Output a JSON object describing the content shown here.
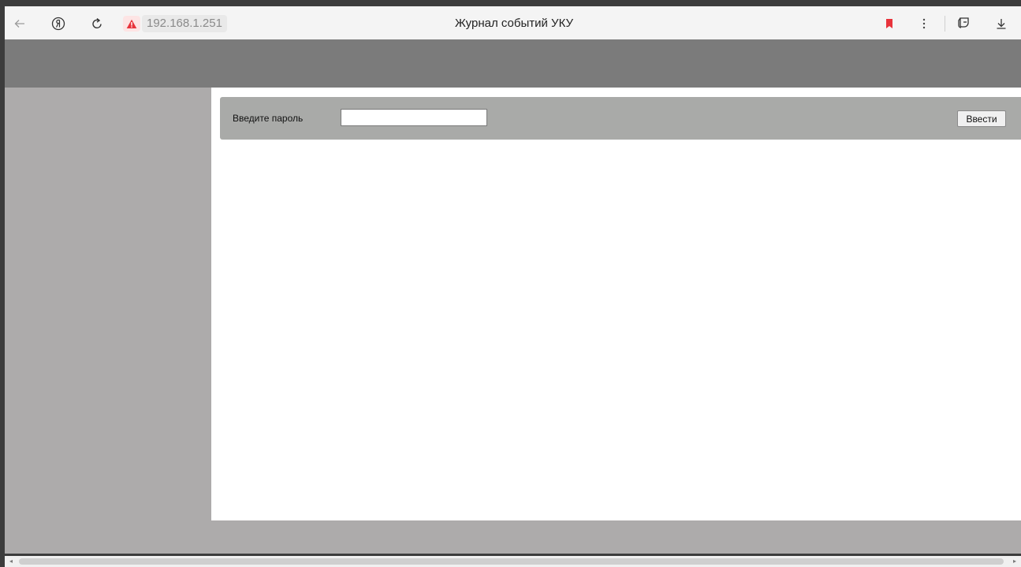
{
  "browser": {
    "url": "192.168.1.251",
    "tab_title": "Журнал событий УКУ",
    "icons": [
      "back-arrow-icon",
      "yandex-logo-icon",
      "reload-icon",
      "security-warning-icon",
      "bookmark-icon",
      "menu-dots-icon",
      "protect-icon",
      "download-icon"
    ],
    "accent_color": "#e8333b"
  },
  "login": {
    "label": "Введите пароль",
    "password_value": "",
    "submit_label": "Ввести"
  },
  "colors": {
    "header_band": "#7b7b7b",
    "sidebar": "#adabab",
    "panel": "#a9aaa8"
  }
}
